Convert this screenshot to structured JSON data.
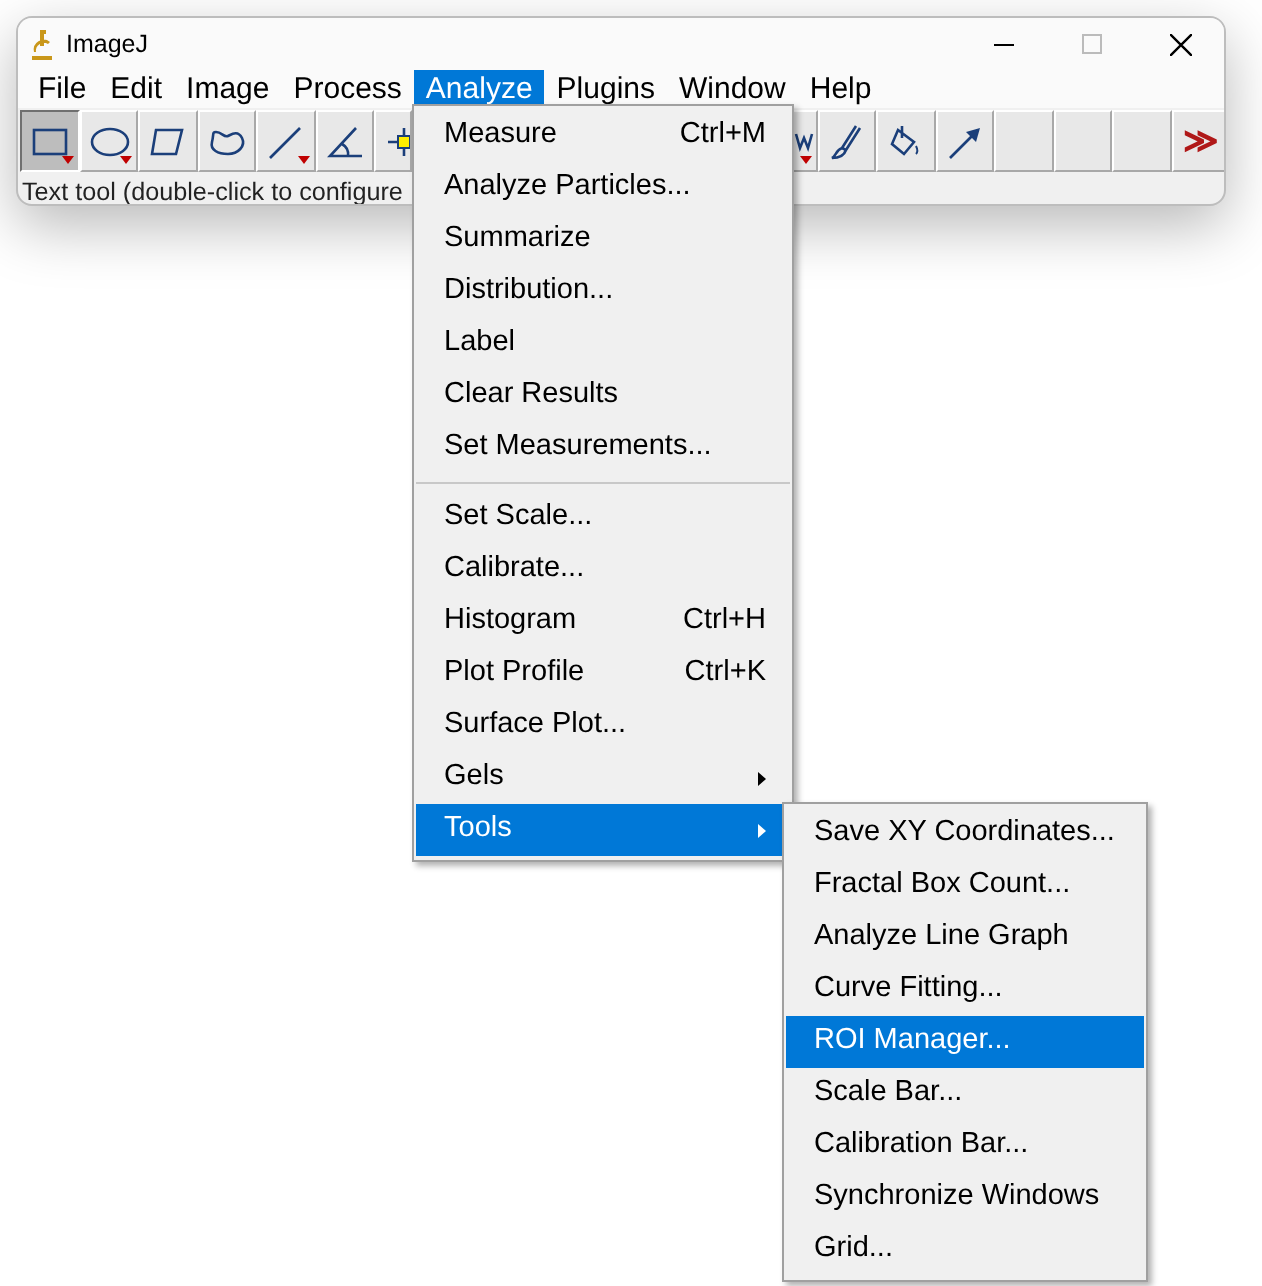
{
  "window": {
    "title": "ImageJ"
  },
  "menubar": [
    {
      "label": "File",
      "selected": false
    },
    {
      "label": "Edit",
      "selected": false
    },
    {
      "label": "Image",
      "selected": false
    },
    {
      "label": "Process",
      "selected": false
    },
    {
      "label": "Analyze",
      "selected": true
    },
    {
      "label": "Plugins",
      "selected": false
    },
    {
      "label": "Window",
      "selected": false
    },
    {
      "label": "Help",
      "selected": false
    }
  ],
  "toolbar_left": [
    {
      "kind": "rectangle",
      "selected": true,
      "dropdown": true
    },
    {
      "kind": "oval",
      "selected": false,
      "dropdown": true
    },
    {
      "kind": "polygon",
      "selected": false,
      "dropdown": false
    },
    {
      "kind": "freehand",
      "selected": false,
      "dropdown": false
    },
    {
      "kind": "line",
      "selected": false,
      "dropdown": true
    },
    {
      "kind": "angle",
      "selected": false,
      "dropdown": false
    },
    {
      "kind": "point",
      "selected": false,
      "dropdown": false
    }
  ],
  "toolbar_right": [
    {
      "kind": "partial",
      "selected": false,
      "dropdown": true
    },
    {
      "kind": "brush",
      "selected": false,
      "dropdown": false
    },
    {
      "kind": "fill",
      "selected": false,
      "dropdown": false
    },
    {
      "kind": "arrow",
      "selected": false,
      "dropdown": false
    },
    {
      "kind": "empty",
      "selected": false,
      "dropdown": false
    },
    {
      "kind": "empty",
      "selected": false,
      "dropdown": false
    },
    {
      "kind": "empty",
      "selected": false,
      "dropdown": false
    },
    {
      "kind": "more",
      "label": "≫",
      "selected": false,
      "dropdown": false
    }
  ],
  "status_bar": "Text tool (double-click to configure",
  "analyze_menu": [
    {
      "kind": "item",
      "label": "Measure",
      "shortcut": "Ctrl+M",
      "selected": false
    },
    {
      "kind": "item",
      "label": "Analyze Particles...",
      "selected": false
    },
    {
      "kind": "item",
      "label": "Summarize",
      "selected": false
    },
    {
      "kind": "item",
      "label": "Distribution...",
      "selected": false
    },
    {
      "kind": "item",
      "label": "Label",
      "selected": false
    },
    {
      "kind": "item",
      "label": "Clear Results",
      "selected": false
    },
    {
      "kind": "item",
      "label": "Set Measurements...",
      "selected": false
    },
    {
      "kind": "separator"
    },
    {
      "kind": "item",
      "label": "Set Scale...",
      "selected": false
    },
    {
      "kind": "item",
      "label": "Calibrate...",
      "selected": false
    },
    {
      "kind": "item",
      "label": "Histogram",
      "shortcut": "Ctrl+H",
      "selected": false
    },
    {
      "kind": "item",
      "label": "Plot Profile",
      "shortcut": "Ctrl+K",
      "selected": false
    },
    {
      "kind": "item",
      "label": "Surface Plot...",
      "selected": false
    },
    {
      "kind": "submenu",
      "label": "Gels",
      "selected": false
    },
    {
      "kind": "submenu",
      "label": "Tools",
      "selected": true
    }
  ],
  "tools_submenu": [
    {
      "label": "Save XY Coordinates...",
      "selected": false
    },
    {
      "label": "Fractal Box Count...",
      "selected": false
    },
    {
      "label": "Analyze Line Graph",
      "selected": false
    },
    {
      "label": "Curve Fitting...",
      "selected": false
    },
    {
      "label": "ROI Manager...",
      "selected": true
    },
    {
      "label": "Scale Bar...",
      "selected": false
    },
    {
      "label": "Calibration Bar...",
      "selected": false
    },
    {
      "label": "Synchronize Windows",
      "selected": false
    },
    {
      "label": "Grid...",
      "selected": false
    }
  ]
}
